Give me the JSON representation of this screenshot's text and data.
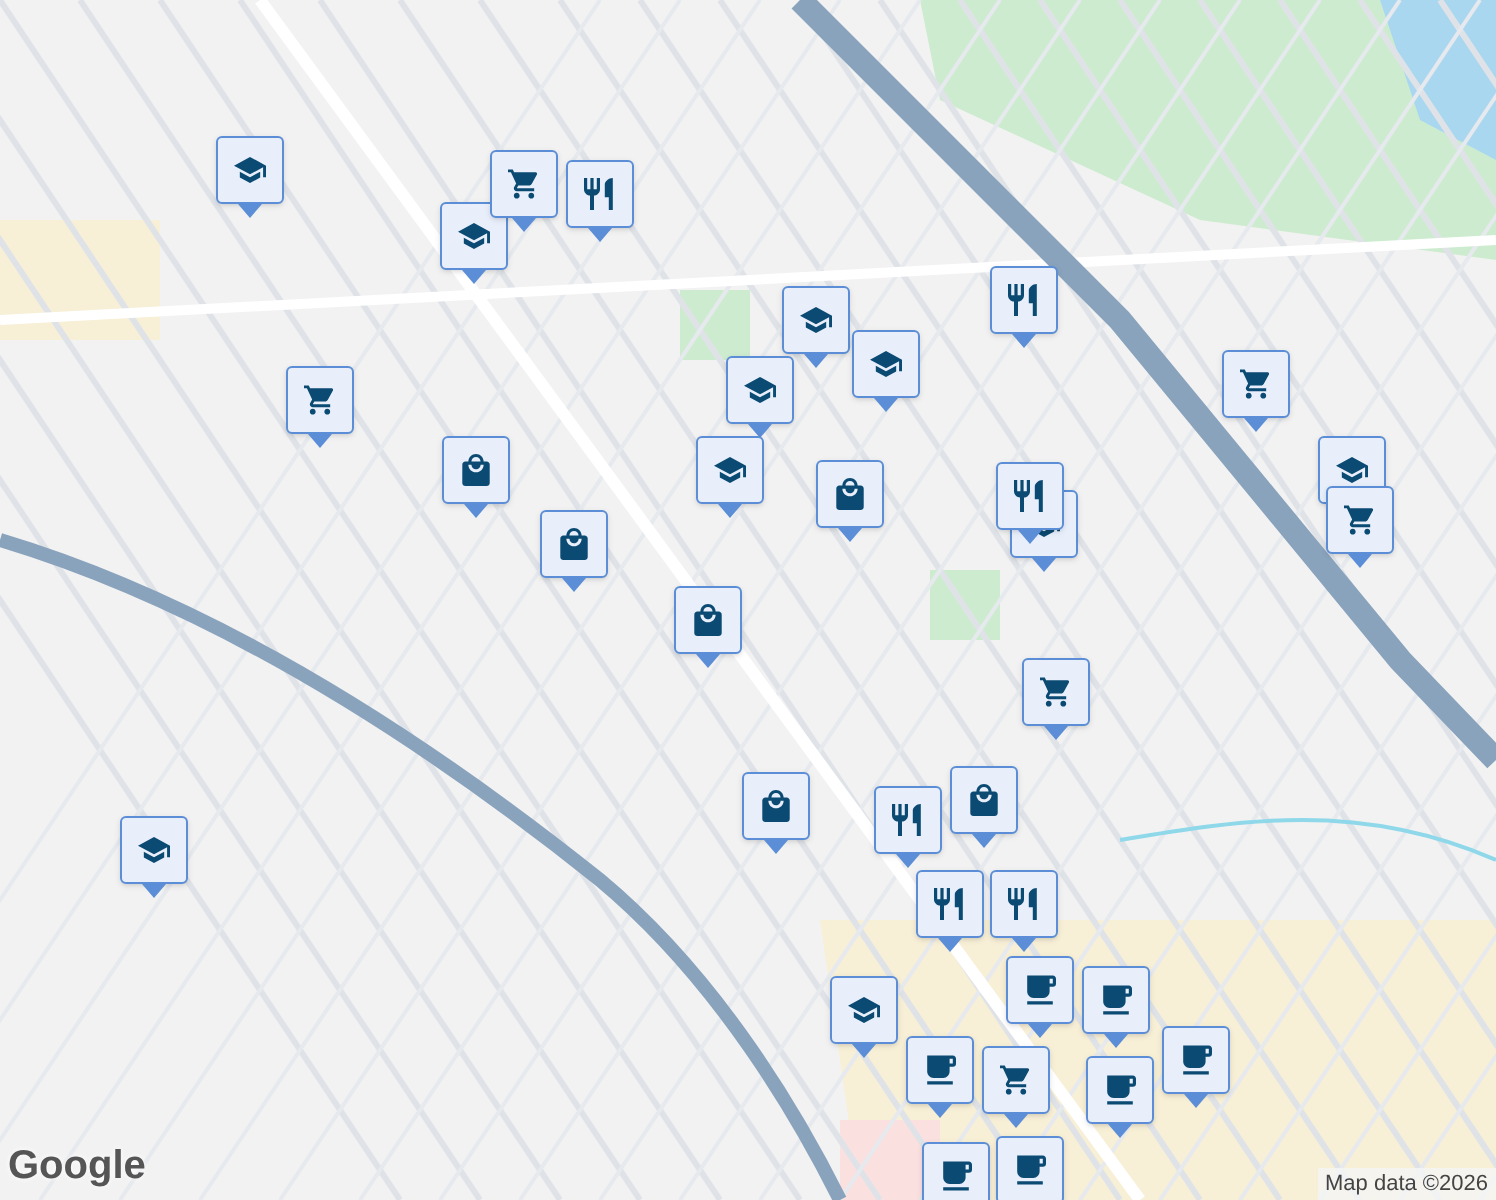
{
  "markers": [
    {
      "kind": "school"
    },
    {
      "kind": "school"
    },
    {
      "kind": "school"
    },
    {
      "kind": "school"
    },
    {
      "kind": "school"
    },
    {
      "kind": "school"
    },
    {
      "kind": "school"
    },
    {
      "kind": "school"
    },
    {
      "kind": "school"
    },
    {
      "kind": "school"
    },
    {
      "kind": "restaurant"
    },
    {
      "kind": "restaurant"
    },
    {
      "kind": "restaurant"
    },
    {
      "kind": "restaurant"
    },
    {
      "kind": "restaurant"
    },
    {
      "kind": "restaurant"
    },
    {
      "kind": "shop"
    },
    {
      "kind": "shop"
    },
    {
      "kind": "shop"
    },
    {
      "kind": "shop"
    },
    {
      "kind": "shop"
    },
    {
      "kind": "shop"
    },
    {
      "kind": "grocery"
    },
    {
      "kind": "grocery"
    },
    {
      "kind": "grocery"
    },
    {
      "kind": "grocery"
    },
    {
      "kind": "grocery"
    },
    {
      "kind": "grocery"
    },
    {
      "kind": "cafe"
    },
    {
      "kind": "cafe"
    },
    {
      "kind": "cafe"
    },
    {
      "kind": "cafe"
    },
    {
      "kind": "cafe"
    },
    {
      "kind": "cafe"
    },
    {
      "kind": "cafe"
    }
  ],
  "logo": "Google",
  "attribution": "Map data ©2026"
}
